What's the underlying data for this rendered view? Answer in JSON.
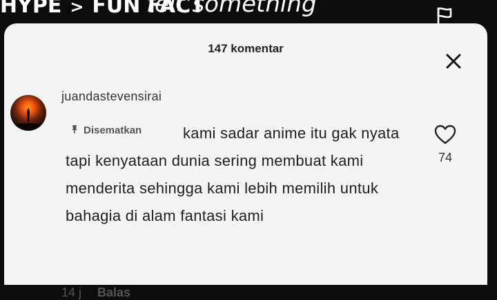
{
  "header": {
    "crumb_left": "HYPE",
    "crumb_separator": ">",
    "crumb_right": "FUN FACT",
    "overlay_text": "felt something",
    "flag_icon": "flag-icon"
  },
  "comments_panel": {
    "count_label": "147 komentar",
    "close_icon": "close-icon"
  },
  "comment": {
    "username": "juandastevensirai",
    "pinned_label": "Disematkan",
    "text": "kami sadar anime itu gak nyata tapi kenyataan dunia sering membuat kami menderita sehingga kami lebih memilih untuk bahagia di alam fantasi kami",
    "like_count": "74",
    "time": "14 j",
    "reply_label": "Balas"
  },
  "colors": {
    "sheet_background": "#f4f4f4",
    "text_primary": "#1e1e1e",
    "text_secondary": "#555555",
    "top_background": "#0c0c0c"
  }
}
